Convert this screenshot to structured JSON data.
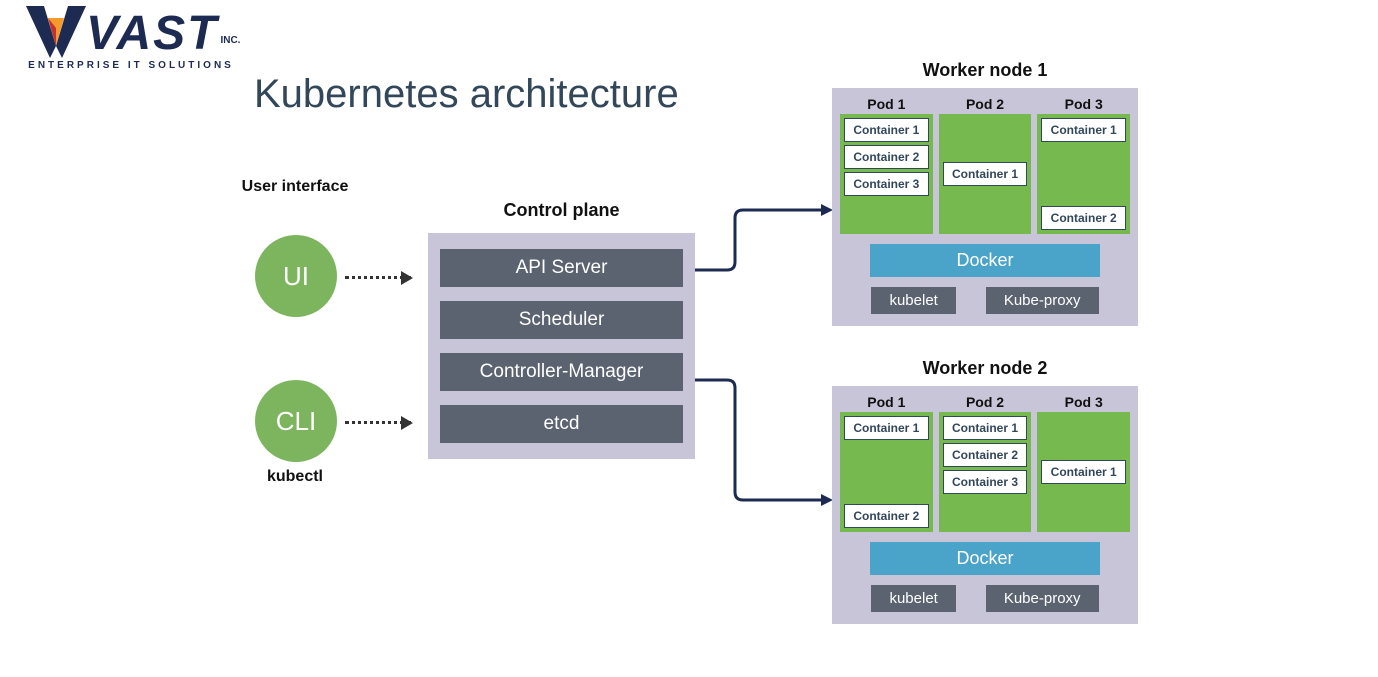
{
  "logo": {
    "name": "VAST",
    "suffix": "INC.",
    "tagline": "ENTERPRISE IT SOLUTIONS"
  },
  "title": "Kubernetes architecture",
  "clients": {
    "ui": {
      "circle": "UI",
      "label": "User interface"
    },
    "cli": {
      "circle": "CLI",
      "label": "kubectl"
    }
  },
  "control_plane": {
    "title": "Control plane",
    "components": [
      "API Server",
      "Scheduler",
      "Controller-Manager",
      "etcd"
    ]
  },
  "workers": [
    {
      "title": "Worker node 1",
      "pods": [
        {
          "title": "Pod 1",
          "containers": [
            "Container 1",
            "Container 2",
            "Container 3"
          ]
        },
        {
          "title": "Pod 2",
          "containers": [
            "Container 1"
          ],
          "center": true
        },
        {
          "title": "Pod 3",
          "containers": [
            "Container 1",
            "Container 2"
          ]
        }
      ],
      "runtime": "Docker",
      "agents": [
        "kubelet",
        "Kube-proxy"
      ]
    },
    {
      "title": "Worker node 2",
      "pods": [
        {
          "title": "Pod 1",
          "containers": [
            "Container 1",
            "Container 2"
          ]
        },
        {
          "title": "Pod 2",
          "containers": [
            "Container 1",
            "Container 2",
            "Container 3"
          ]
        },
        {
          "title": "Pod 3",
          "containers": [
            "Container 1"
          ],
          "center": true
        }
      ],
      "runtime": "Docker",
      "agents": [
        "kubelet",
        "Kube-proxy"
      ]
    }
  ]
}
